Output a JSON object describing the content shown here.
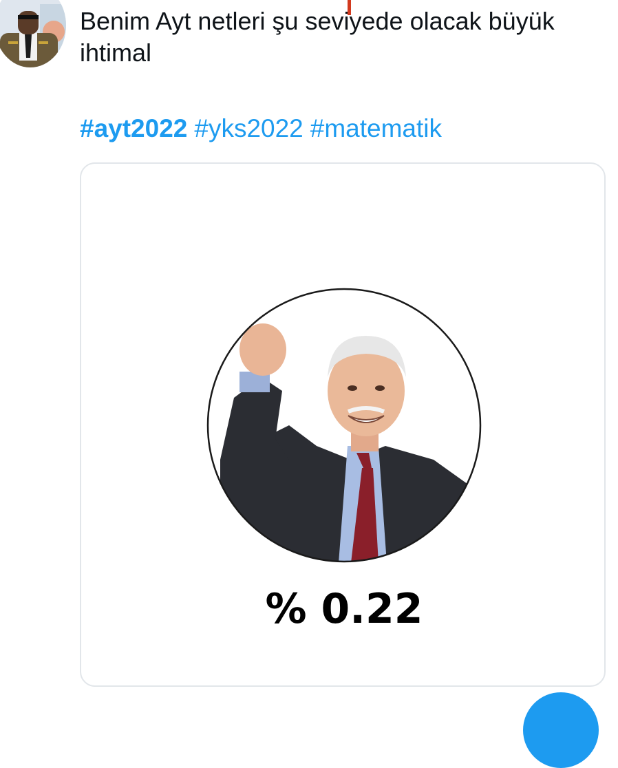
{
  "tweet": {
    "text": "Benim Ayt netleri şu seviyede olacak büyük ihtimal",
    "hashtags": [
      "#ayt2022",
      "#yks2022",
      "#matematik"
    ],
    "link_color": "#1d9bf0"
  },
  "media": {
    "caption": "% 0.22"
  },
  "icons": {
    "avatar": "user-avatar",
    "compose": "compose-button"
  }
}
